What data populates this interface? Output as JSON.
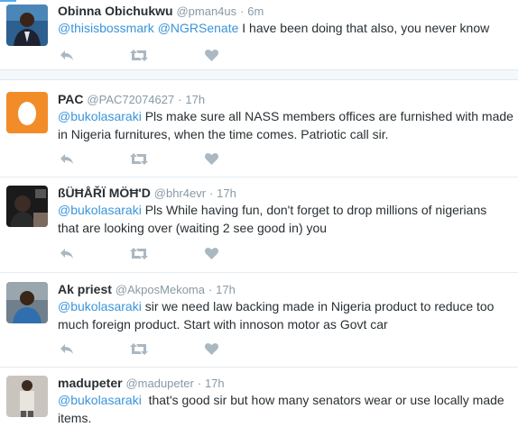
{
  "colors": {
    "link": "#3b94d9",
    "meta": "#8899a6",
    "action_icon": "#aab8c2"
  },
  "tweets": [
    {
      "name": "Obinna Obichukwu",
      "handle": "@pman4us",
      "separator": "·",
      "time": "6m",
      "mentions": [
        "@thisisbossmark",
        "@NGRSenate"
      ],
      "text": " I have been doing that also,  you never know",
      "text2": "",
      "avatar": "photo-portrait"
    },
    {
      "name": "PAC",
      "handle": "@PAC72074627",
      "separator": "·",
      "time": "17h",
      "mentions": [
        "@bukolasaraki"
      ],
      "text": " Pls make sure all NASS members offices are furnished with made",
      "text2": "in Nigeria furnitures, when the time comes. Patriotic call sir.",
      "avatar": "egg-default"
    },
    {
      "name": "ßÜĦÅŘÏ MÖĦ'D",
      "handle": "@bhr4evr",
      "separator": "·",
      "time": "17h",
      "mentions": [
        "@bukolasaraki"
      ],
      "text": " Pls While having fun, don't forget to drop millions of nigerians",
      "text2": "that are looking over (waiting 2 see good in) you",
      "avatar": "photo-dark"
    },
    {
      "name": "Ak priest",
      "handle": "@AkposMekoma",
      "separator": "·",
      "time": "17h",
      "mentions": [
        "@bukolasaraki"
      ],
      "text": " sir we need law backing made in Nigeria product to reduce too",
      "text2": "much foreign product. Start with innoson motor as Govt car",
      "avatar": "photo-person"
    },
    {
      "name": "madupeter",
      "handle": "@madupeter",
      "separator": "·",
      "time": "17h",
      "mentions": [
        "@bukolasaraki"
      ],
      "text": "  that's good sir but how many senators wear or use locally made",
      "text2": "items.",
      "avatar": "photo-standing"
    }
  ]
}
